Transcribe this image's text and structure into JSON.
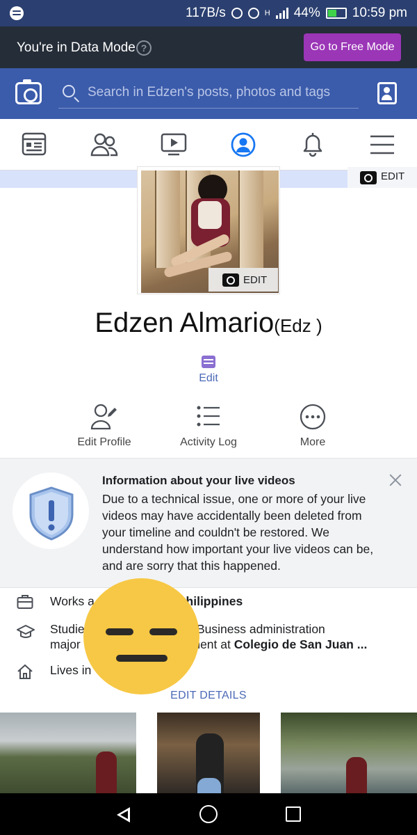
{
  "status_bar": {
    "speed": "117B/s",
    "network": "H",
    "battery": "44%",
    "time": "10:59 pm"
  },
  "data_mode": {
    "text": "You're in Data Mode",
    "help": "?",
    "button": "Go to Free Mode",
    "button_color": "#9b36b7"
  },
  "search": {
    "placeholder": "Search in Edzen's posts, photos and tags"
  },
  "nav": {
    "active": "profile",
    "accent": "#1877f2"
  },
  "cover": {
    "edit_label": "EDIT"
  },
  "profile": {
    "photo_edit_label": "EDIT",
    "name": "Edzen Almario",
    "nickname": "(Edz )",
    "edit_label": "Edit"
  },
  "actions": [
    {
      "label": "Edit Profile"
    },
    {
      "label": "Activity Log"
    },
    {
      "label": "More"
    }
  ],
  "notice": {
    "title": "Information about your live videos",
    "body": "Due to a technical issue, one or more of your live videos may have accidentally been deleted from your timeline and couldn't be restored. We understand how important your live videos can be, and are sorry that this happened."
  },
  "details": {
    "works_prefix": "Works a",
    "works_bold": "Philippines",
    "studied_line1_prefix": "Studie",
    "studied_line1_suffix": "ce Business administration",
    "studied_line2_prefix": "major",
    "studied_line2_mid": "ement at",
    "studied_line2_bold": "Colegio de San Juan ...",
    "lives_prefix": "Lives in",
    "edit_details": "EDIT DETAILS"
  }
}
